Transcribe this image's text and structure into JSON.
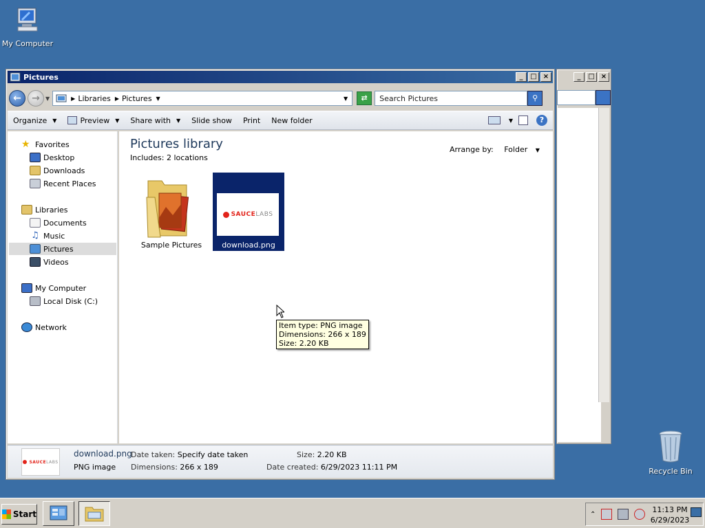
{
  "desktop": {
    "my_computer_label": "My Computer",
    "recycle_bin_label": "Recycle Bin"
  },
  "window": {
    "title": "Pictures",
    "minimize_glyph": "_",
    "maximize_glyph": "□",
    "close_glyph": "×"
  },
  "address": {
    "crumbs": [
      "Libraries",
      "Pictures"
    ],
    "search_placeholder": "Search Pictures"
  },
  "toolbar": {
    "organize": "Organize",
    "preview": "Preview",
    "share_with": "Share with",
    "slide_show": "Slide show",
    "print": "Print",
    "new_folder": "New folder"
  },
  "nav": {
    "favorites": "Favorites",
    "desktop": "Desktop",
    "downloads": "Downloads",
    "recent_places": "Recent Places",
    "libraries": "Libraries",
    "documents": "Documents",
    "music": "Music",
    "pictures": "Pictures",
    "videos": "Videos",
    "my_computer": "My Computer",
    "local_disk": "Local Disk (C:)",
    "network": "Network"
  },
  "content": {
    "title": "Pictures library",
    "includes": "Includes:  2 locations",
    "arrange_by_label": "Arrange by:",
    "arrange_by_value": "Folder",
    "items": [
      {
        "name": "Sample Pictures",
        "type": "folder"
      },
      {
        "name": "download.png",
        "type": "png",
        "selected": true
      }
    ]
  },
  "tooltip": {
    "line1": "Item type: PNG image",
    "line2": "Dimensions: 266 x 189",
    "line3": "Size: 2.20 KB"
  },
  "thumbnail": {
    "logo_main": "SAUCE",
    "logo_sub": "LABS"
  },
  "details": {
    "name": "download.png",
    "type": "PNG image",
    "date_taken_label": "Date taken:",
    "date_taken_value": "Specify date taken",
    "dimensions_label": "Dimensions:",
    "dimensions_value": "266 x 189",
    "size_label": "Size:",
    "size_value": "2.20 KB",
    "date_created_label": "Date created:",
    "date_created_value": "6/29/2023 11:11 PM"
  },
  "taskbar": {
    "start_label": "Start",
    "time": "11:13 PM",
    "date": "6/29/2023"
  },
  "colors": {
    "desktop": "#3a6ea5",
    "title_active": "#0a246a",
    "selection": "#0a246a",
    "tooltip_bg": "#ffffe1",
    "brand_red": "#e2231a"
  }
}
